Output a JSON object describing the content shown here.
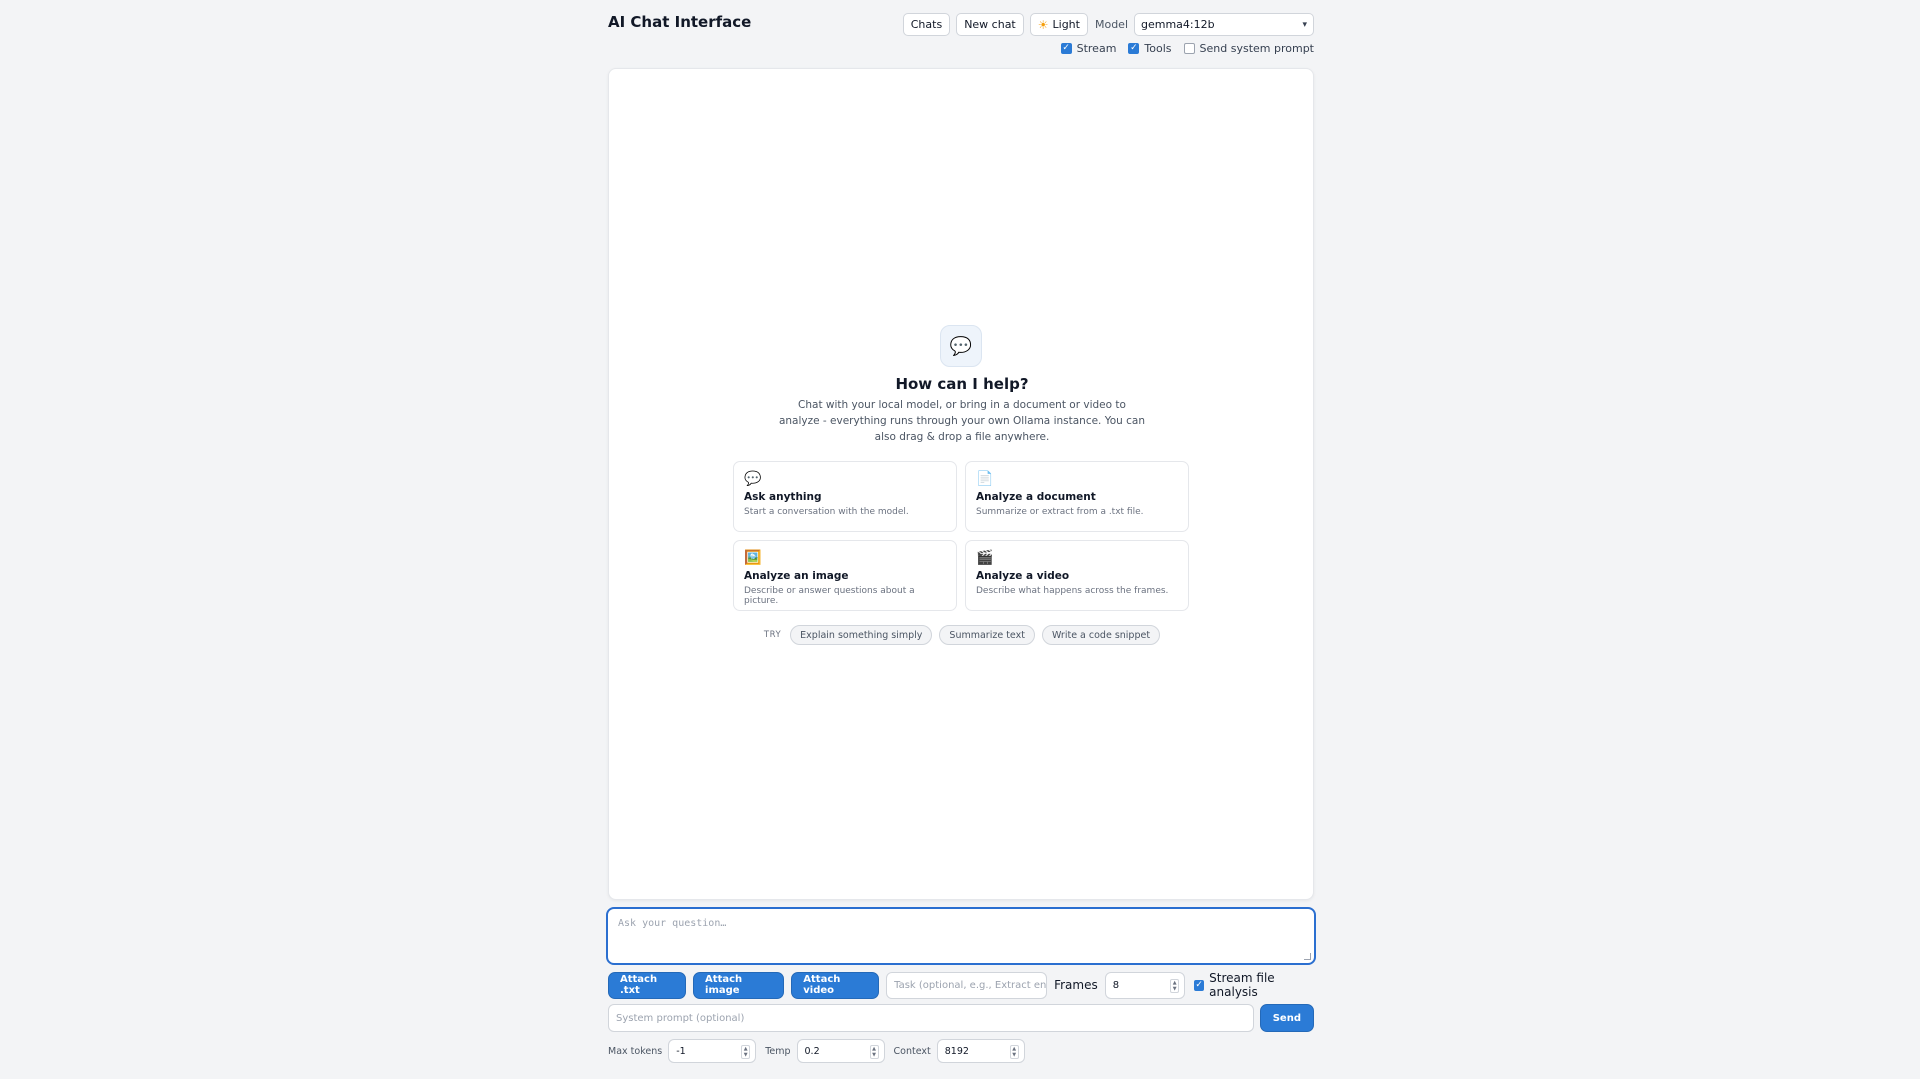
{
  "header": {
    "title": "AI Chat Interface",
    "chats_label": "Chats",
    "new_chat_label": "New chat",
    "theme_label": "Light",
    "model_label": "Model",
    "model_value": "gemma4:12b"
  },
  "options": {
    "stream": {
      "label": "Stream",
      "checked": true
    },
    "tools": {
      "label": "Tools",
      "checked": true
    },
    "send_system_prompt": {
      "label": "Send system prompt",
      "checked": false
    }
  },
  "welcome": {
    "title": "How can I help?",
    "subtitle": "Chat with your local model, or bring in a document or video to analyze - everything runs through your own Ollama instance. You can also drag & drop a file anywhere."
  },
  "cards": [
    {
      "icon": "speech-bubble-icon",
      "title": "Ask anything",
      "desc": "Start a conversation with the model."
    },
    {
      "icon": "document-icon",
      "title": "Analyze a document",
      "desc": "Summarize or extract from a .txt file."
    },
    {
      "icon": "picture-icon",
      "title": "Analyze an image",
      "desc": "Describe or answer questions about a picture."
    },
    {
      "icon": "clapper-icon",
      "title": "Analyze a video",
      "desc": "Describe what happens across the frames."
    }
  ],
  "try": {
    "label": "TRY",
    "chips": [
      "Explain something simply",
      "Summarize text",
      "Write a code snippet"
    ]
  },
  "composer": {
    "question_placeholder": "Ask your question…",
    "attach_txt": "Attach .txt",
    "attach_image": "Attach image",
    "attach_video": "Attach video",
    "task_placeholder": "Task (optional, e.g., Extract entities &",
    "frames_label": "Frames",
    "frames_value": "8",
    "stream_analysis_label": "Stream file analysis",
    "stream_analysis_checked": true,
    "system_prompt_placeholder": "System prompt (optional)",
    "send_label": "Send"
  },
  "params": {
    "max_tokens_label": "Max tokens",
    "max_tokens_value": "-1",
    "temp_label": "Temp",
    "temp_value": "0.2",
    "context_label": "Context",
    "context_value": "8192"
  },
  "colors": {
    "accent": "#2b7bd6",
    "background": "#f3f4f6",
    "panel": "#ffffff"
  }
}
